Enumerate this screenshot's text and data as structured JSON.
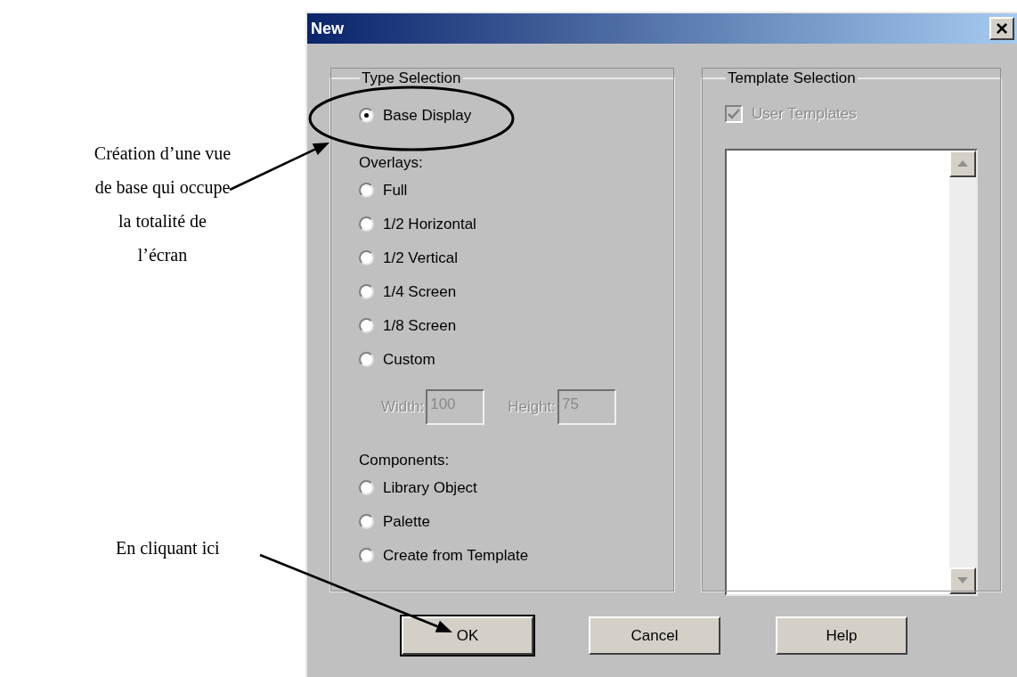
{
  "annotations": [
    {
      "text": "Création d’une vue de base qui occupe la totalité de l’écran"
    },
    {
      "text": "En cliquant ici"
    }
  ],
  "dialog": {
    "title": "New",
    "close": "×",
    "type_selection": {
      "title": "Type Selection",
      "items": [
        {
          "kind": "radio",
          "label": "Base Display",
          "selected": true
        },
        {
          "kind": "heading",
          "label": "Overlays:"
        },
        {
          "kind": "radio",
          "label": "Full",
          "selected": false
        },
        {
          "kind": "radio",
          "label": "1/2 Horizontal",
          "selected": false
        },
        {
          "kind": "radio",
          "label": "1/2 Vertical",
          "selected": false
        },
        {
          "kind": "radio",
          "label": "1/4 Screen",
          "selected": false
        },
        {
          "kind": "radio",
          "label": "1/8 Screen",
          "selected": false
        },
        {
          "kind": "radio",
          "label": "Custom",
          "selected": false
        },
        {
          "kind": "fields",
          "fields": [
            {
              "label": "Width:",
              "value": "100",
              "disabled": true
            },
            {
              "label": "Height:",
              "value": "75",
              "disabled": true
            }
          ]
        },
        {
          "kind": "heading",
          "label": "Components:"
        },
        {
          "kind": "radio",
          "label": "Library Object",
          "selected": false
        },
        {
          "kind": "radio",
          "label": "Palette",
          "selected": false
        },
        {
          "kind": "radio",
          "label": "Create from Template",
          "selected": false
        }
      ]
    },
    "template_selection": {
      "title": "Template Selection",
      "user_templates": {
        "label": "User Templates",
        "checked": true,
        "disabled": true
      }
    },
    "buttons": [
      {
        "label": "OK",
        "default": true
      },
      {
        "label": "Cancel",
        "default": false
      },
      {
        "label": "Help",
        "default": false
      }
    ]
  }
}
